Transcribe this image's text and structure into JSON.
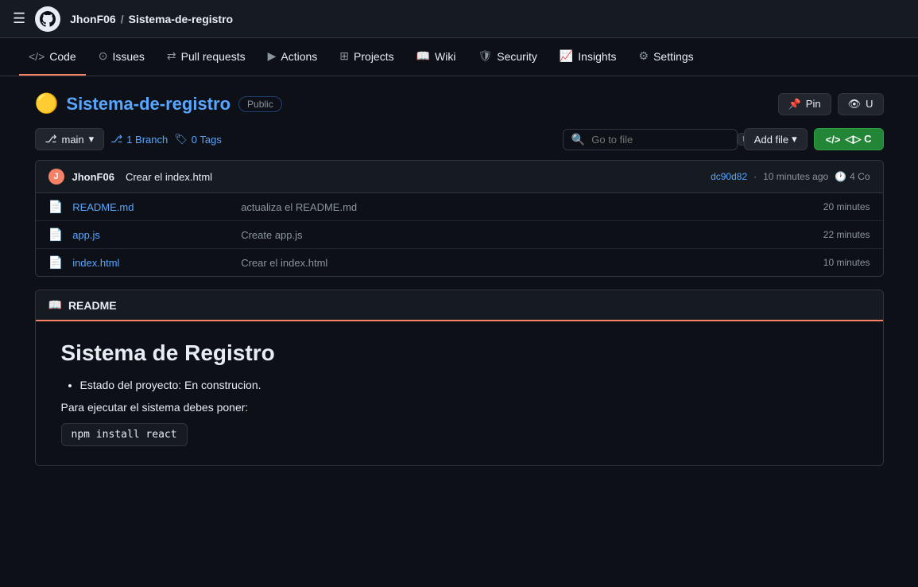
{
  "topnav": {
    "user": "JhonF06",
    "repo": "Sistema-de-registro",
    "separator": "/"
  },
  "reponav": {
    "items": [
      {
        "id": "code",
        "label": "Code",
        "icon": "</>",
        "active": true
      },
      {
        "id": "issues",
        "label": "Issues",
        "icon": "⊙"
      },
      {
        "id": "pull-requests",
        "label": "Pull requests",
        "icon": "⇄"
      },
      {
        "id": "actions",
        "label": "Actions",
        "icon": "▶"
      },
      {
        "id": "projects",
        "label": "Projects",
        "icon": "⊞"
      },
      {
        "id": "wiki",
        "label": "Wiki",
        "icon": "📖"
      },
      {
        "id": "security",
        "label": "Security",
        "icon": "🛡"
      },
      {
        "id": "insights",
        "label": "Insights",
        "icon": "📈"
      },
      {
        "id": "settings",
        "label": "Settings",
        "icon": "⚙"
      }
    ]
  },
  "repo": {
    "emoji": "🟡",
    "name": "Sistema-de-registro",
    "visibility": "Public",
    "pin_label": "Pin",
    "unwatch_label": "U"
  },
  "branch": {
    "current": "main",
    "branch_count": "1 Branch",
    "tag_count": "0 Tags",
    "go_to_file_placeholder": "Go to file",
    "add_file_label": "Add file",
    "code_label": "◁▷ C"
  },
  "commit": {
    "user": "JhonF06",
    "avatar_letter": "J",
    "message": "Crear el index.html",
    "hash": "dc90d82",
    "time": "10 minutes ago",
    "count": "4 Co"
  },
  "files": [
    {
      "name": "README.md",
      "commit_msg": "actualiza el README.md",
      "time": "20 minutes"
    },
    {
      "name": "app.js",
      "commit_msg": "Create app.js",
      "time": "22 minutes"
    },
    {
      "name": "index.html",
      "commit_msg": "Crear el index.html",
      "time": "10 minutes"
    }
  ],
  "readme": {
    "title": "README",
    "heading": "Sistema de Registro",
    "bullet": "Estado del proyecto: En construcion.",
    "para": "Para ejecutar el sistema debes poner:",
    "code": "npm install react"
  }
}
